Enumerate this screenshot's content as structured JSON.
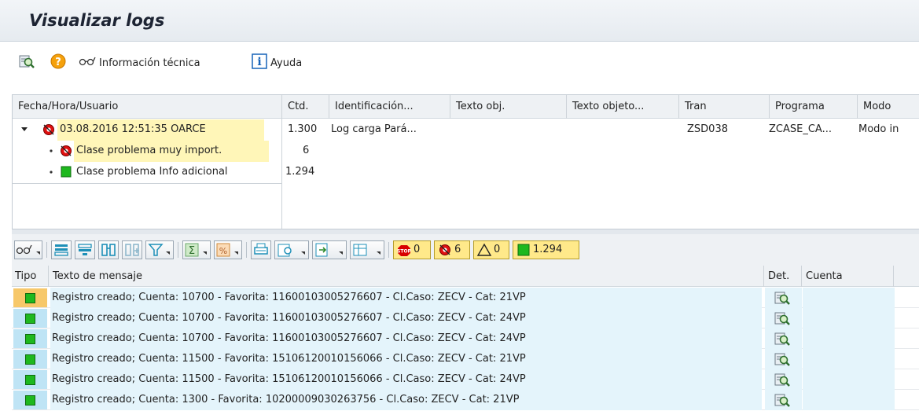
{
  "title": "Visualizar logs",
  "toolbar": {
    "tech_info_label": "Información técnica",
    "help_label": "Ayuda"
  },
  "tree": {
    "columns": [
      "Fecha/Hora/Usuario",
      "Ctd.",
      "Identificación...",
      "Texto obj.",
      "Texto objeto...",
      "Tran",
      "Programa",
      "Modo"
    ],
    "root": {
      "label": "03.08.2016  12:51:35  OARCE",
      "count": "1.300",
      "identification": "Log carga Pará...",
      "tran": "ZSD038",
      "program": "ZCASE_CA...",
      "mode": "Modo in"
    },
    "children": [
      {
        "label": "Clase problema muy import.",
        "count": "6",
        "status": "error"
      },
      {
        "label": "Clase problema Info adicional",
        "count": "1.294",
        "status": "info"
      }
    ]
  },
  "grid_toolbar": {
    "counters": {
      "stop": "0",
      "error": "6",
      "warning": "0",
      "info": "1.294"
    }
  },
  "grid": {
    "columns": {
      "type": "Tipo",
      "message": "Texto de mensaje",
      "detail": "Det.",
      "account": "Cuenta"
    },
    "rows": [
      "Registro creado; Cuenta: 10700 - Favorita: 11600103005276607 - Cl.Caso: ZECV - Cat: 21VP",
      "Registro creado; Cuenta: 10700 - Favorita: 11600103005276607 - Cl.Caso: ZECV - Cat: 24VP",
      "Registro creado; Cuenta: 10700 - Favorita: 11600103005276607 - Cl.Caso: ZECV - Cat: 24VP",
      "Registro creado; Cuenta: 11500 - Favorita: 15106120010156066 - Cl.Caso: ZECV - Cat: 21VP",
      "Registro creado; Cuenta: 11500 - Favorita: 15106120010156066 - Cl.Caso: ZECV - Cat: 24VP",
      "Registro creado; Cuenta: 1300 - Favorita: 10200009030263756 - Cl.Caso: ZECV - Cat: 21VP"
    ]
  },
  "colors": {
    "error_red": "#e01010",
    "info_green": "#1eb81e",
    "highlight_yellow": "#fff6b8",
    "type_cell_blue": "#bfe4f5",
    "type_cell_selected": "#f7c86a"
  }
}
